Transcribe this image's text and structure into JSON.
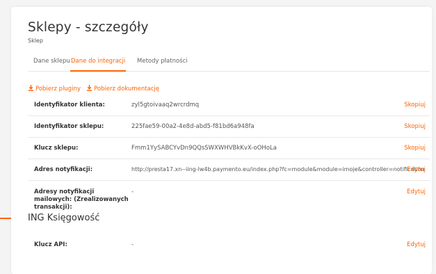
{
  "page": {
    "title": "Sklepy - szczegóły",
    "subtitle": "Sklep"
  },
  "tabs": [
    {
      "label": "Dane sklepu",
      "active": false
    },
    {
      "label": "Dane do integracji",
      "active": true
    },
    {
      "label": "Metody płatności",
      "active": false
    }
  ],
  "downloads": [
    {
      "label": "Pobierz pluginy",
      "icon": "download-icon"
    },
    {
      "label": "Pobierz dokumentację",
      "icon": "download-icon"
    }
  ],
  "integration_rows": [
    {
      "label": "Identyfikator klienta:",
      "value": "zyl5gtoivaaq2wrcrdmq",
      "action": "Skopiuj"
    },
    {
      "label": "Identyfikator sklepu:",
      "value": "225fae59-00a2-4e8d-abd5-f81bd6a948fa",
      "action": "Skopiuj"
    },
    {
      "label": "Klucz sklepu:",
      "value": "Fmm1YySABCYvDn9QQsSWXWHVBkKvX-oOHoLa",
      "action": "Skopiuj"
    },
    {
      "label": "Adres notyfikacji:",
      "value": "http://presta17.xn--iing-lw4b.paymento.eu/index.php?fc=module&module=imoje&controller=notification",
      "action": "Edytuj"
    },
    {
      "label": "Adresy notyfikacji mailowych: (Zrealizowanych transakcji):",
      "value": "-",
      "action": "Edytuj"
    }
  ],
  "accounting": {
    "heading": "ING Księgowość",
    "rows": [
      {
        "label": "Klucz API:",
        "value": "-",
        "action": "Edytuj"
      }
    ]
  },
  "colors": {
    "accent": "#ff6200",
    "text": "#333333",
    "muted": "#666666",
    "border": "#e8e8e8",
    "background": "#f4f4f4"
  }
}
